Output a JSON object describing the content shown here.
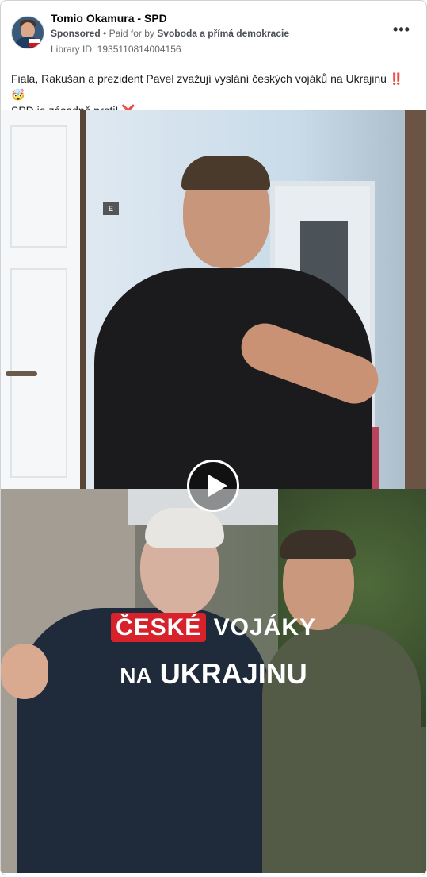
{
  "header": {
    "page_name": "Tomio Okamura - SPD",
    "sponsored": "Sponsored",
    "paid_for_prefix": "Paid for by",
    "payer": "Svoboda a přímá demokracie",
    "library_id": "Library ID: 1935110814004156",
    "more_icon": "more-horizontal-icon"
  },
  "post": {
    "text_line1": "Fiala, Rakušan a prezident Pavel zvažují vyslání českých vojáků na Ukrajinu",
    "emoji1": "‼️",
    "emoji2": "🤯",
    "text_line2": "SPD je zásadně proti!",
    "emoji3": "❌"
  },
  "video": {
    "sign_text": "E",
    "caption_highlight": "ČESKÉ",
    "caption_rest": "VOJÁKY",
    "caption_line2_small": "NA",
    "caption_line2_big": "UKRAJINU",
    "play_icon": "play-icon",
    "accent_color": "#d7222b"
  }
}
